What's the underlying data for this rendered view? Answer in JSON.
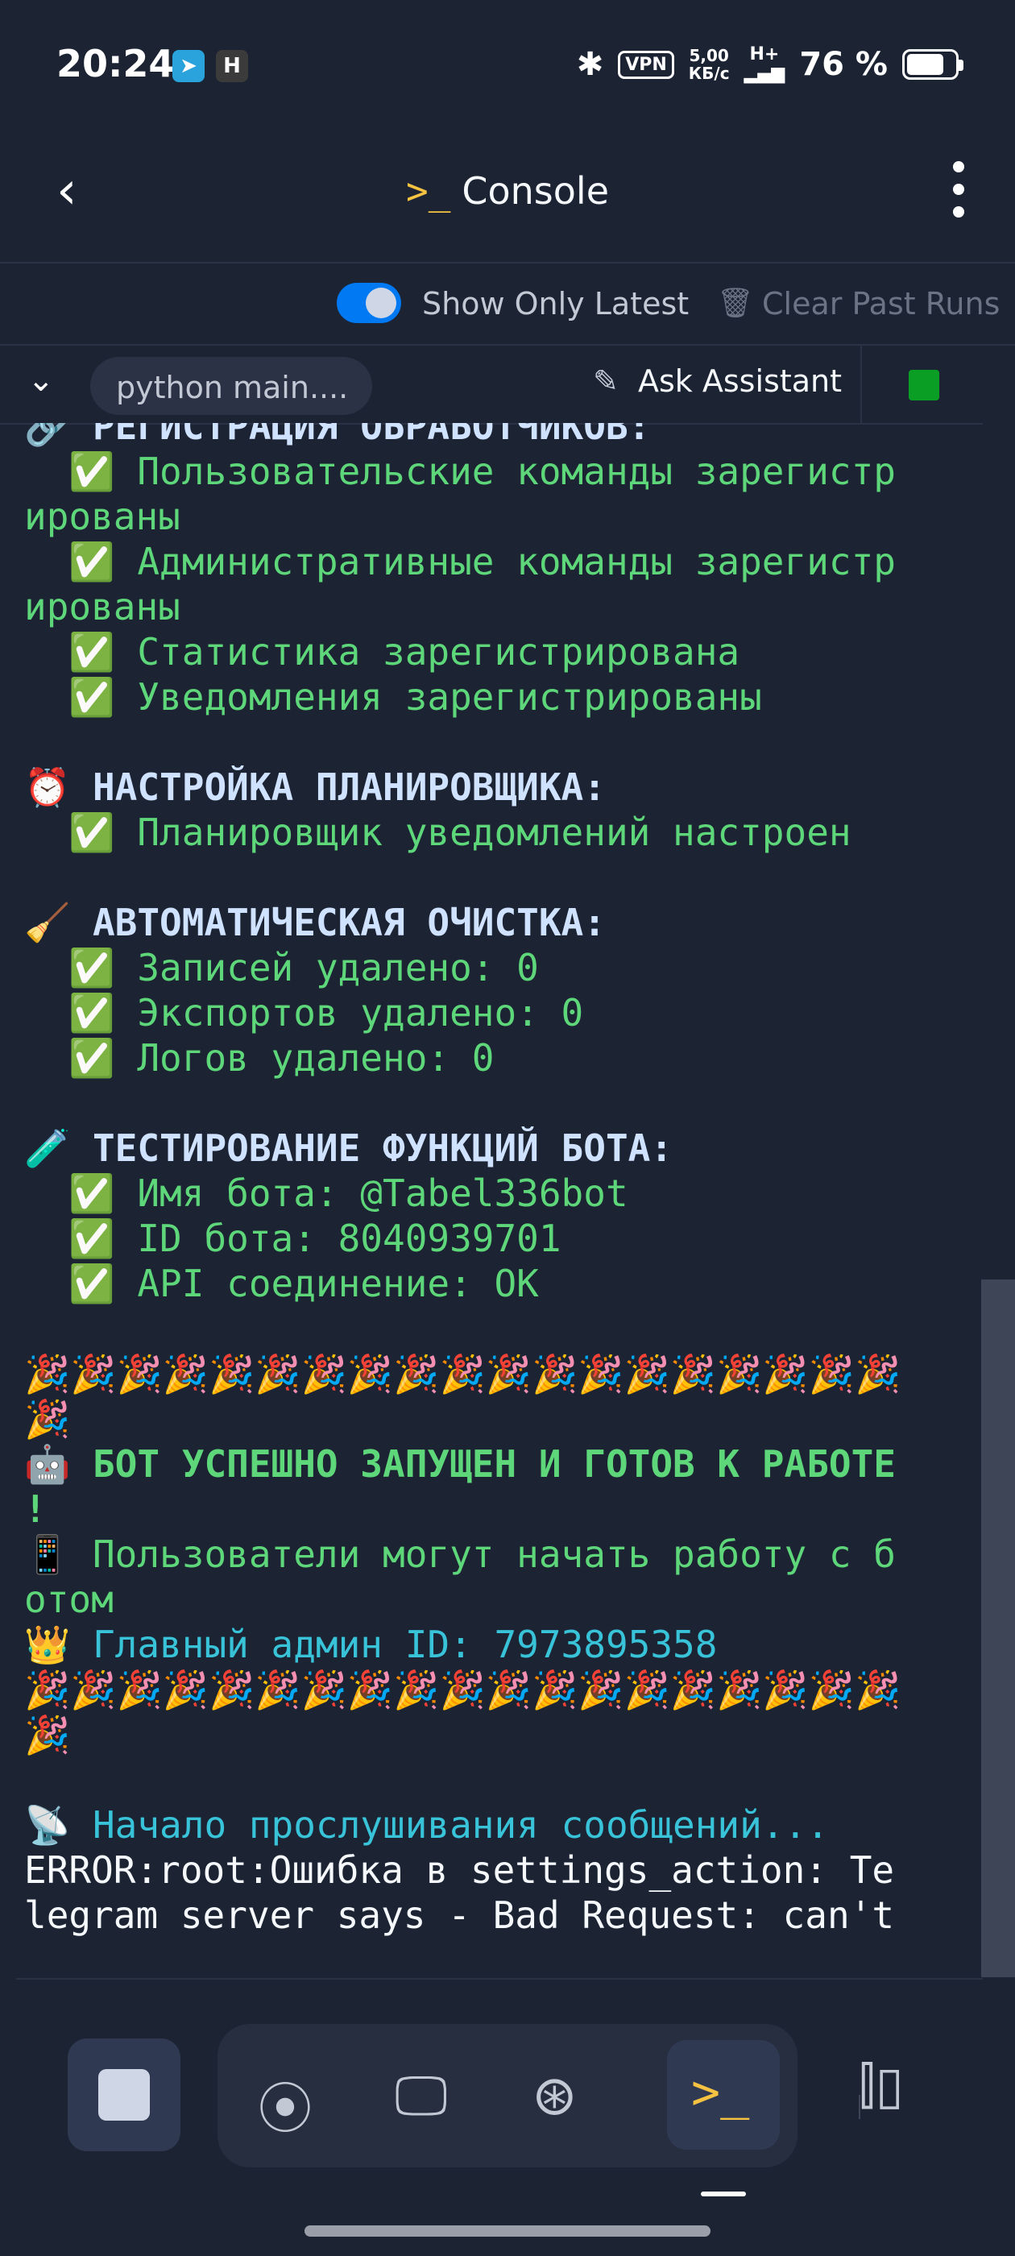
{
  "status_bar": {
    "time": "20:24",
    "app_icons": [
      "telegram-icon",
      "h-icon"
    ],
    "vpn": "VPN",
    "net_speed_value": "5,00",
    "net_speed_unit": "КБ/с",
    "network": "H+",
    "battery": "76 %"
  },
  "header": {
    "title": "Console",
    "prompt_icon": ">_"
  },
  "controls": {
    "show_latest_label": "Show Only Latest",
    "show_latest_on": true,
    "clear_runs_label": "Clear Past Runs"
  },
  "tab_row": {
    "run_tab": "python main....",
    "ask_assistant": "Ask Assistant",
    "status_color": "#0a9e24"
  },
  "console": {
    "lines": [
      {
        "text": "🔗 РЕГИСТРАЦИЯ ОБРАБОТЧИКОВ:",
        "style": "h"
      },
      {
        "text": "  ✅ Пользовательские команды зарегистр",
        "style": "g"
      },
      {
        "text": "ированы",
        "style": "g"
      },
      {
        "text": "  ✅ Административные команды зарегистр",
        "style": "g"
      },
      {
        "text": "ированы",
        "style": "g"
      },
      {
        "text": "  ✅ Статистика зарегистрирована",
        "style": "g"
      },
      {
        "text": "  ✅ Уведомления зарегистрированы",
        "style": "g"
      },
      {
        "text": "",
        "style": "w"
      },
      {
        "text": "⏰ НАСТРОЙКА ПЛАНИРОВЩИКА:",
        "style": "h"
      },
      {
        "text": "  ✅ Планировщик уведомлений настроен",
        "style": "g"
      },
      {
        "text": "",
        "style": "w"
      },
      {
        "text": "🧹 АВТОМАТИЧЕСКАЯ ОЧИСТКА:",
        "style": "h"
      },
      {
        "text": "  ✅ Записей удалено: 0",
        "style": "g"
      },
      {
        "text": "  ✅ Экспортов удалено: 0",
        "style": "g"
      },
      {
        "text": "  ✅ Логов удалено: 0",
        "style": "g"
      },
      {
        "text": "",
        "style": "w"
      },
      {
        "text": "🧪 ТЕСТИРОВАНИЕ ФУНКЦИЙ БОТА:",
        "style": "h"
      },
      {
        "text": "  ✅ Имя бота: @Tabel336bot",
        "style": "g"
      },
      {
        "text": "  ✅ ID бота: 8040939701",
        "style": "g"
      },
      {
        "text": "  ✅ API соединение: OK",
        "style": "g"
      },
      {
        "text": "",
        "style": "w"
      },
      {
        "text": "🎉🎉🎉🎉🎉🎉🎉🎉🎉🎉🎉🎉🎉🎉🎉🎉🎉🎉🎉",
        "style": "w"
      },
      {
        "text": "🎉",
        "style": "w"
      },
      {
        "text": "🤖 БОТ УСПЕШНО ЗАПУЩЕН И ГОТОВ К РАБОТЕ",
        "style": "gb"
      },
      {
        "text": "!",
        "style": "gb"
      },
      {
        "text": "📱 Пользователи могут начать работу с б",
        "style": "g"
      },
      {
        "text": "отом",
        "style": "g"
      },
      {
        "text": "👑 Главный админ ID: 7973895358",
        "style": "c"
      },
      {
        "text": "🎉🎉🎉🎉🎉🎉🎉🎉🎉🎉🎉🎉🎉🎉🎉🎉🎉🎉🎉",
        "style": "w"
      },
      {
        "text": "🎉",
        "style": "w"
      },
      {
        "text": "",
        "style": "w"
      },
      {
        "text": "📡 Начало прослушивания сообщений...",
        "style": "c"
      },
      {
        "text": "ERROR:root:Ошибка в settings_action: Te",
        "style": "w"
      },
      {
        "text": "legram server says - Bad Request: can't",
        "style": "w"
      }
    ]
  },
  "bottom_nav": {
    "items": [
      "stop-icon",
      "git-icon",
      "webview-icon",
      "deploy-icon",
      "console-icon",
      "panes-icon"
    ],
    "console_glyph": ">_"
  }
}
